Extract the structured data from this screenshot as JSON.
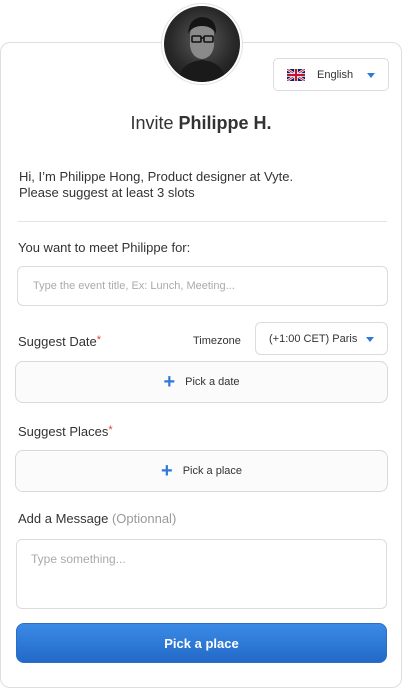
{
  "language": {
    "label": "English",
    "flag": "uk-flag-icon"
  },
  "invite": {
    "prefix": "Invite",
    "name": "Philippe H."
  },
  "intro": {
    "line1": "Hi, I’m Philippe Hong, Product designer at Vyte.",
    "line2": "Please suggest at least 3 slots"
  },
  "event": {
    "label": "You want to meet Philippe for:",
    "placeholder": "Type the event title, Ex: Lunch, Meeting..."
  },
  "date": {
    "label": "Suggest Date",
    "required_mark": "*",
    "timezone_label": "Timezone",
    "timezone_value": "(+1:00 CET) Paris",
    "pick_label": "Pick a date"
  },
  "places": {
    "label": "Suggest Places",
    "required_mark": "*",
    "pick_label": "Pick a place"
  },
  "message": {
    "label": "Add a Message",
    "optional": "(Optionnal)",
    "placeholder": "Type something..."
  },
  "submit": {
    "label": "Pick a place"
  },
  "colors": {
    "accent": "#2f7ad8",
    "required": "#e03b3b",
    "button": "#2a6ec6"
  }
}
